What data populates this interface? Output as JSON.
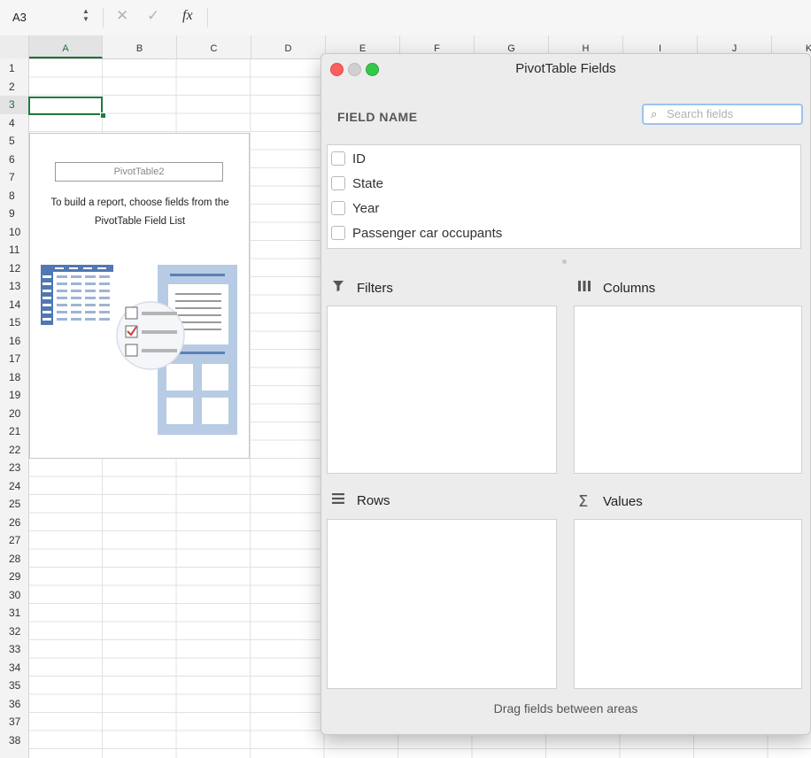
{
  "formula_bar": {
    "cell_reference": "A3",
    "fx_label": "fx",
    "formula_value": ""
  },
  "grid": {
    "columns": [
      "A",
      "B",
      "C",
      "D",
      "E",
      "F",
      "G",
      "H",
      "I",
      "J",
      "K"
    ],
    "rows": [
      "1",
      "2",
      "3",
      "4",
      "5",
      "6",
      "7",
      "8",
      "9",
      "10",
      "11",
      "12",
      "13",
      "14",
      "15",
      "16",
      "17",
      "18",
      "19",
      "20",
      "21",
      "22",
      "23",
      "24",
      "25",
      "26",
      "27",
      "28",
      "29",
      "30",
      "31",
      "32",
      "33",
      "34",
      "35",
      "36",
      "37",
      "38"
    ],
    "selected_column": "A",
    "selected_row": "3"
  },
  "pivot_placeholder": {
    "name": "PivotTable2",
    "help_text": "To build a report, choose fields from the PivotTable Field List"
  },
  "pivot_panel": {
    "title": "PivotTable Fields",
    "field_name_label": "FIELD NAME",
    "search_placeholder": "Search fields",
    "fields": [
      {
        "label": "ID",
        "checked": false
      },
      {
        "label": "State",
        "checked": false
      },
      {
        "label": "Year",
        "checked": false
      },
      {
        "label": "Passenger car occupants",
        "checked": false
      }
    ],
    "areas": {
      "filters": "Filters",
      "columns": "Columns",
      "rows": "Rows",
      "values": "Values"
    },
    "footer": "Drag fields between areas"
  },
  "colors": {
    "selection_green": "#1f7a3f",
    "close_button": "#fc605c",
    "zoom_button": "#34c84a",
    "search_focus": "#9cc3ef",
    "illustration_blue": "#5b80b6"
  }
}
